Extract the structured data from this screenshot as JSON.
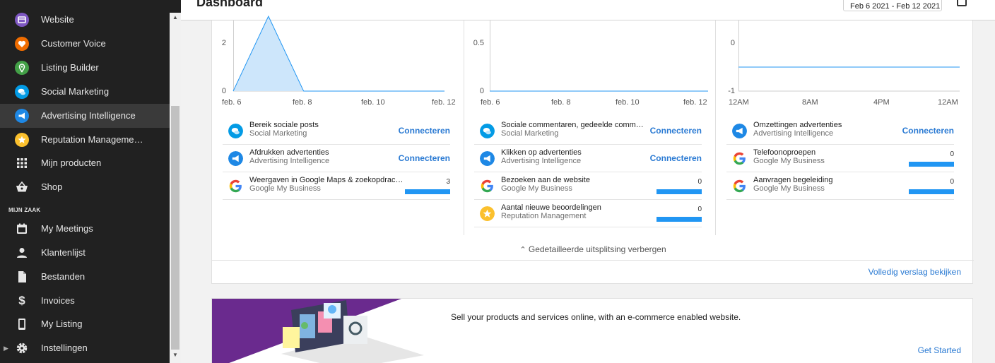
{
  "header": {
    "title": "Dashboard",
    "date_range": "Feb 6 2021 - Feb 12 2021"
  },
  "sidebar": {
    "items": [
      {
        "label": "Website",
        "icon": "website-icon",
        "color": "#7e57c2"
      },
      {
        "label": "Customer Voice",
        "icon": "customer-voice-icon",
        "color": "#ef6c00"
      },
      {
        "label": "Listing Builder",
        "icon": "listing-builder-icon",
        "color": "#43a047"
      },
      {
        "label": "Social Marketing",
        "icon": "social-marketing-icon",
        "color": "#039be5"
      },
      {
        "label": "Advertising Intelligence",
        "icon": "advertising-intelligence-icon",
        "color": "#1e88e5"
      },
      {
        "label": "Reputation Manageme…",
        "icon": "reputation-management-icon",
        "color": "#fbc02d"
      },
      {
        "label": "Mijn producten",
        "icon": "grid-icon"
      },
      {
        "label": "Shop",
        "icon": "basket-icon"
      }
    ],
    "section_label": "MIJN ZAAK",
    "section_items": [
      {
        "label": "My Meetings",
        "icon": "calendar-icon"
      },
      {
        "label": "Klantenlijst",
        "icon": "person-icon"
      },
      {
        "label": "Bestanden",
        "icon": "file-icon"
      },
      {
        "label": "Invoices",
        "icon": "dollar-icon"
      },
      {
        "label": "My Listing",
        "icon": "phone-icon"
      },
      {
        "label": "Instellingen",
        "icon": "gear-icon"
      }
    ]
  },
  "charts": [
    {
      "y_ticks": [
        "2",
        "0"
      ],
      "x_ticks": [
        "feb. 6",
        "feb. 8",
        "feb. 10",
        "feb. 12"
      ]
    },
    {
      "y_ticks": [
        "0.5",
        "0"
      ],
      "x_ticks": [
        "feb. 6",
        "feb. 8",
        "feb. 10",
        "feb. 12"
      ]
    },
    {
      "y_ticks": [
        "0",
        "-1"
      ],
      "x_ticks": [
        "12AM",
        "8AM",
        "4PM",
        "12AM"
      ]
    }
  ],
  "chart_data": [
    {
      "type": "area",
      "x": [
        "feb. 6",
        "feb. 7",
        "feb. 8",
        "feb. 9",
        "feb. 10",
        "feb. 11",
        "feb. 12"
      ],
      "values": [
        0,
        3,
        0,
        0,
        0,
        0,
        0
      ],
      "ylim": [
        0,
        3
      ],
      "color": "#2196f3"
    },
    {
      "type": "line",
      "x": [
        "feb. 6",
        "feb. 12"
      ],
      "values": [
        0,
        0
      ],
      "ylim": [
        0,
        1
      ],
      "color": "#2196f3"
    },
    {
      "type": "line",
      "x": [
        "12AM",
        "12AM"
      ],
      "values": [
        0,
        0
      ],
      "ylim": [
        -1,
        1
      ],
      "color": "#2196f3"
    }
  ],
  "columns": [
    [
      {
        "title": "Bereik sociale posts",
        "source": "Social Marketing",
        "icon": "social-marketing-icon",
        "color": "#039be5",
        "action": "Connecteren"
      },
      {
        "title": "Afdrukken advertenties",
        "source": "Advertising Intelligence",
        "icon": "advertising-intelligence-icon",
        "color": "#1e88e5",
        "action": "Connecteren"
      },
      {
        "title": "Weergaven in Google Maps & zoekopdrac…",
        "source": "Google My Business",
        "icon": "google-icon",
        "value": "3",
        "bar": 1.0
      }
    ],
    [
      {
        "title": "Sociale commentaren, gedeelde comm…",
        "source": "Social Marketing",
        "icon": "social-marketing-icon",
        "color": "#039be5",
        "action": "Connecteren"
      },
      {
        "title": "Klikken op advertenties",
        "source": "Advertising Intelligence",
        "icon": "advertising-intelligence-icon",
        "color": "#1e88e5",
        "action": "Connecteren"
      },
      {
        "title": "Bezoeken aan de website",
        "source": "Google My Business",
        "icon": "google-icon",
        "value": "0",
        "bar": 1.0
      },
      {
        "title": "Aantal nieuwe beoordelingen",
        "source": "Reputation Management",
        "icon": "reputation-management-icon",
        "color": "#fbc02d",
        "value": "0",
        "bar": 1.0
      }
    ],
    [
      {
        "title": "Omzettingen advertenties",
        "source": "Advertising Intelligence",
        "icon": "advertising-intelligence-icon",
        "color": "#1e88e5",
        "action": "Connecteren"
      },
      {
        "title": "Telefoonoproepen",
        "source": "Google My Business",
        "icon": "google-icon",
        "value": "0",
        "bar": 1.0
      },
      {
        "title": "Aanvragen begeleiding",
        "source": "Google My Business",
        "icon": "google-icon",
        "value": "0",
        "bar": 1.0
      }
    ]
  ],
  "breakdown_toggle": "Gedetailleerde uitsplitsing verbergen",
  "full_report": "Volledig verslag bekijken",
  "promo": {
    "text": "Sell your products and services online, with an e-commerce enabled website.",
    "cta": "Get Started"
  },
  "accent_color": "#2a7ad3"
}
